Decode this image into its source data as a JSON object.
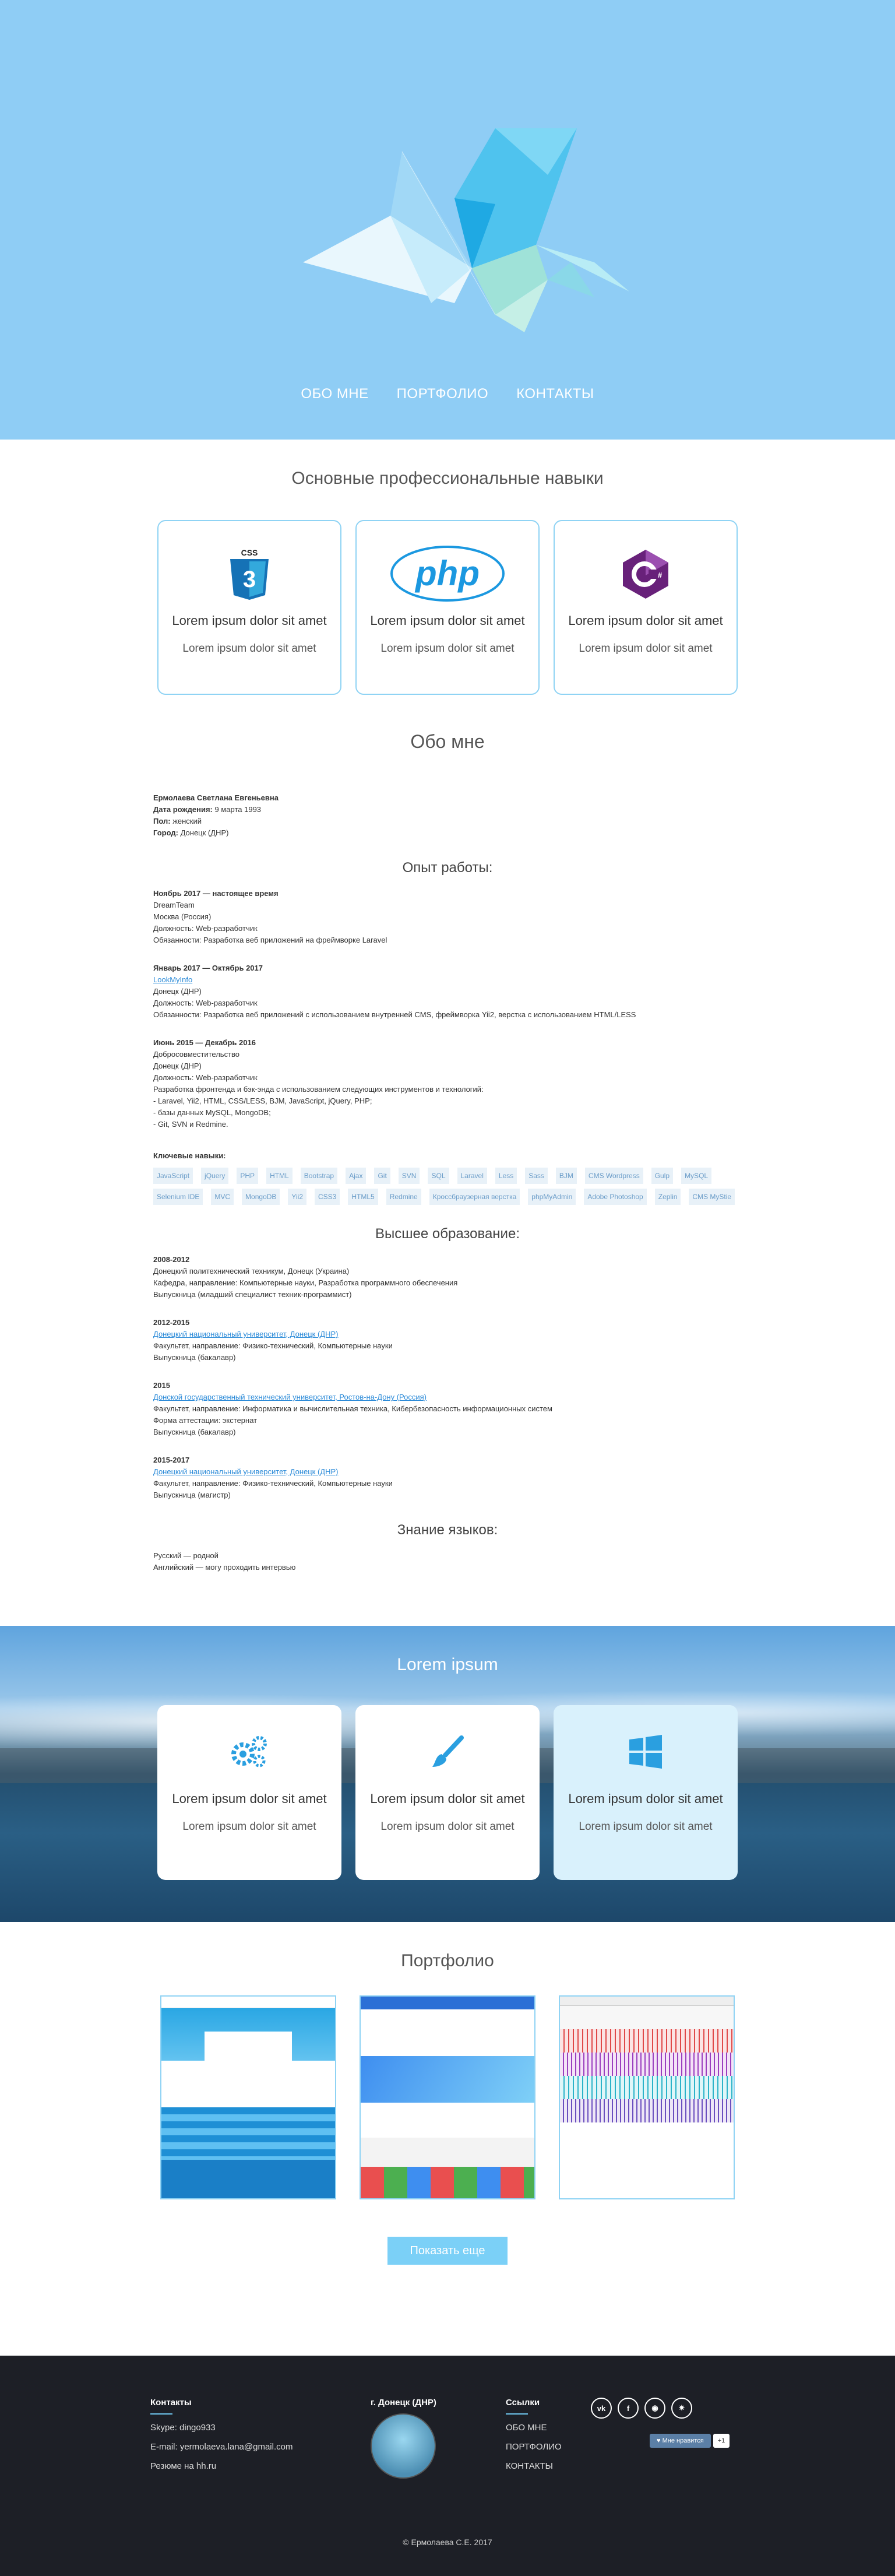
{
  "nav": [
    "ОБО МНЕ",
    "ПОРТФОЛИО",
    "КОНТАКТЫ"
  ],
  "skills": {
    "title": "Основные профессиональные навыки",
    "cards": [
      {
        "logo": "CSS",
        "title": "Lorem ipsum dolor sit amet",
        "text": "Lorem ipsum dolor sit amet"
      },
      {
        "logo": "php",
        "title": "Lorem ipsum dolor sit amet",
        "text": "Lorem ipsum dolor sit amet"
      },
      {
        "logo": "C#",
        "title": "Lorem ipsum dolor sit amet",
        "text": "Lorem ipsum dolor sit amet"
      }
    ]
  },
  "about": {
    "title": "Обо мне",
    "name": "Ермолаева Светлана Евгеньевна",
    "birth_label": "Дата рождения:",
    "birth": "9 марта 1993",
    "sex_label": "Пол:",
    "sex": "женский",
    "city_label": "Город:",
    "city": "Донецк (ДНР)",
    "work_title": "Опыт работы:",
    "jobs": [
      {
        "period": "Ноябрь 2017 — настоящее время",
        "lines": [
          "DreamTeam",
          "Москва (Россия)",
          "Должность: Web-разработчик",
          "Обязанности: Разработка веб приложений на фреймворке Laravel"
        ]
      },
      {
        "period": "Январь 2017 — Октябрь 2017",
        "company": "LookMyInfo",
        "lines": [
          "Донецк (ДНР)",
          "Должность: Web-разработчик",
          "Обязанности: Разработка веб приложений с использованием внутренней CMS, фреймворка Yii2, верстка с использованием HTML/LESS"
        ]
      },
      {
        "period": "Июнь 2015 — Декабрь 2016",
        "lines": [
          "Добросовместительство",
          "Донецк (ДНР)",
          "Должность: Web-разработчик",
          "Разработка фронтенда и бэк-энда с использованием следующих инструментов и технологий:",
          "- Laravel, Yii2, HTML, CSS/LESS, BJM, JavaScript, jQuery, PHP;",
          "- базы данных MySQL, MongoDB;",
          "- Git, SVN и Redmine."
        ]
      }
    ],
    "keywords_title": "Ключевые навыки:",
    "tags": [
      "JavaScript",
      "jQuery",
      "PHP",
      "HTML",
      "Bootstrap",
      "Ajax",
      "Git",
      "SVN",
      "SQL",
      "Laravel",
      "Less",
      "Sass",
      "BJM",
      "CMS Wordpress",
      "Gulp",
      "MySQL",
      "Selenium IDE",
      "MVC",
      "MongoDB",
      "Yii2",
      "CSS3",
      "HTML5",
      "Redmine",
      "Кроссбраузерная верстка",
      "phpMyAdmin",
      "Adobe Photoshop",
      "Zeplin",
      "CMS MyStie"
    ],
    "edu_title": "Высшее образование:",
    "edu": [
      {
        "years": "2008-2012",
        "lines": [
          "Донецкий политехнический техникум, Донецк (Украина)",
          "Кафедра, направление: Компьютерные науки, Разработка программного обеспечения",
          "Выпускница (младший специалист техник-программист)"
        ]
      },
      {
        "years": "2012-2015",
        "link": "Донецкий национальный университет, Донецк (ДНР)",
        "lines": [
          "Факультет, направление: Физико-технический, Компьютерные науки",
          "Выпускница (бакалавр)"
        ]
      },
      {
        "years": "2015",
        "link": "Донской государственный технический университет, Ростов-на-Дону (Россия)",
        "lines": [
          "Факультет, направление: Информатика и вычислительная техника, Кибербезопасность информационных систем",
          "Форма аттестации: экстернат",
          "Выпускница (бакалавр)"
        ]
      },
      {
        "years": "2015-2017",
        "link": "Донецкий национальный университет, Донецк (ДНР)",
        "lines": [
          "Факультет, направление: Физико-технический, Компьютерные науки",
          "Выпускница (магистр)"
        ]
      }
    ],
    "lang_title": "Знание языков:",
    "langs": [
      "Русский — родной",
      "Английский — могу проходить интервью"
    ]
  },
  "lorem": {
    "title": "Lorem ipsum",
    "cards": [
      {
        "icon": "gears-icon",
        "title": "Lorem ipsum dolor sit amet",
        "text": "Lorem ipsum dolor sit amet"
      },
      {
        "icon": "brush-icon",
        "title": "Lorem ipsum dolor sit amet",
        "text": "Lorem ipsum dolor sit amet"
      },
      {
        "icon": "windows-icon",
        "title": "Lorem ipsum dolor sit amet",
        "text": "Lorem ipsum dolor sit amet"
      }
    ]
  },
  "portfolio": {
    "title": "Портфолио",
    "more": "Показать еще"
  },
  "footer": {
    "contacts_title": "Контакты",
    "skype": "Skype: dingo933",
    "email": "E-mail: yermolaeva.lana@gmail.com",
    "resume": "Резюме на hh.ru",
    "city": "г. Донецк (ДНР)",
    "links_title": "Ссылки",
    "links": [
      "ОБО МНЕ",
      "ПОРТФОЛИО",
      "КОНТАКТЫ"
    ],
    "social": [
      "vk-icon",
      "facebook-icon",
      "github-icon",
      "bitbucket-icon"
    ],
    "like_label": "Мне нравится",
    "like_count": "+1",
    "copyright": "© Ермолаева С.Е. 2017"
  },
  "colors": {
    "accent": "#8fcdf5",
    "border": "#8fd3f4",
    "button": "#7bd0f7",
    "footer": "#1d1f26"
  }
}
